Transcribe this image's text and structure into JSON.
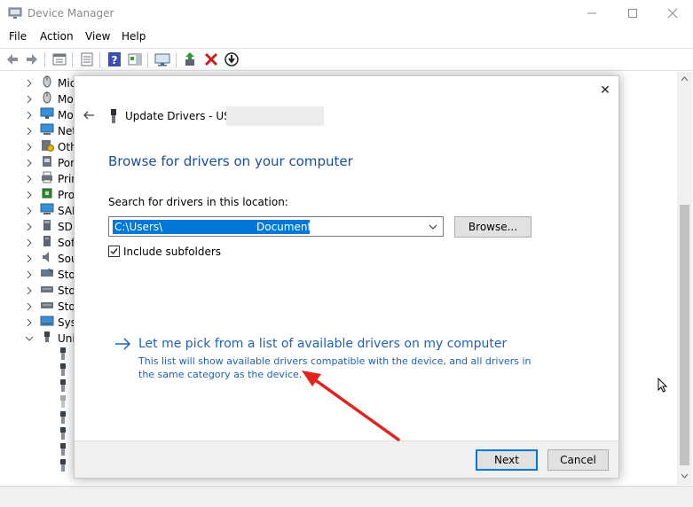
{
  "window": {
    "title": "Device Manager",
    "minimize_glyph": "—",
    "maximize_glyph": "☐",
    "close_glyph": "✕"
  },
  "menu": [
    "File",
    "Action",
    "View",
    "Help"
  ],
  "toolbar": {
    "icons": [
      "back-icon",
      "forward-icon",
      "properties-icon",
      "show-hide-icon",
      "help-icon",
      "action-pane-icon",
      "monitor-icon",
      "update-driver-icon",
      "uninstall-icon",
      "scan-icon"
    ]
  },
  "tree": {
    "categories": [
      {
        "label": "Mic",
        "icon": "mouse-icon"
      },
      {
        "label": "Mo",
        "icon": "mouse-icon"
      },
      {
        "label": "Mo",
        "icon": "monitor-icon"
      },
      {
        "label": "Net",
        "icon": "network-icon"
      },
      {
        "label": "Oth",
        "icon": "other-device-icon"
      },
      {
        "label": "Por",
        "icon": "port-icon"
      },
      {
        "label": "Prin",
        "icon": "print-queue-icon"
      },
      {
        "label": "Pro",
        "icon": "processor-icon"
      },
      {
        "label": "SAN",
        "icon": "san-icon"
      },
      {
        "label": "SD",
        "icon": "sd-icon"
      },
      {
        "label": "Sof",
        "icon": "software-icon"
      },
      {
        "label": "Sou",
        "icon": "sound-icon"
      },
      {
        "label": "Sto",
        "icon": "storage-icon"
      },
      {
        "label": "Sto",
        "icon": "storage-icon"
      },
      {
        "label": "Sto",
        "icon": "storage-icon"
      },
      {
        "label": "Sys",
        "icon": "system-icon"
      },
      {
        "label": "Uni",
        "icon": "usb-controller-icon",
        "expanded": true
      }
    ],
    "usb_children_count": 8
  },
  "dialog": {
    "close_glyph": "✕",
    "title": "Update Drivers - USB",
    "heading": "Browse for drivers on your computer",
    "search_label": "Search for drivers in this location:",
    "path_value_start": "C:\\Users\\",
    "path_value_end": "Documents",
    "browse_label": "Browse...",
    "include_subfolders_label": "Include subfolders",
    "include_subfolders_checked": true,
    "pick_title": "Let me pick from a list of available drivers on my computer",
    "pick_desc": "This list will show available drivers compatible with the device, and all drivers in the same category as the device.",
    "next_label": "Next",
    "cancel_label": "Cancel"
  },
  "colors": {
    "heading_blue": "#1a4e9c",
    "link_blue": "#1f61b5",
    "selection_blue": "#0078d7",
    "annotation_red": "#e3211d"
  }
}
